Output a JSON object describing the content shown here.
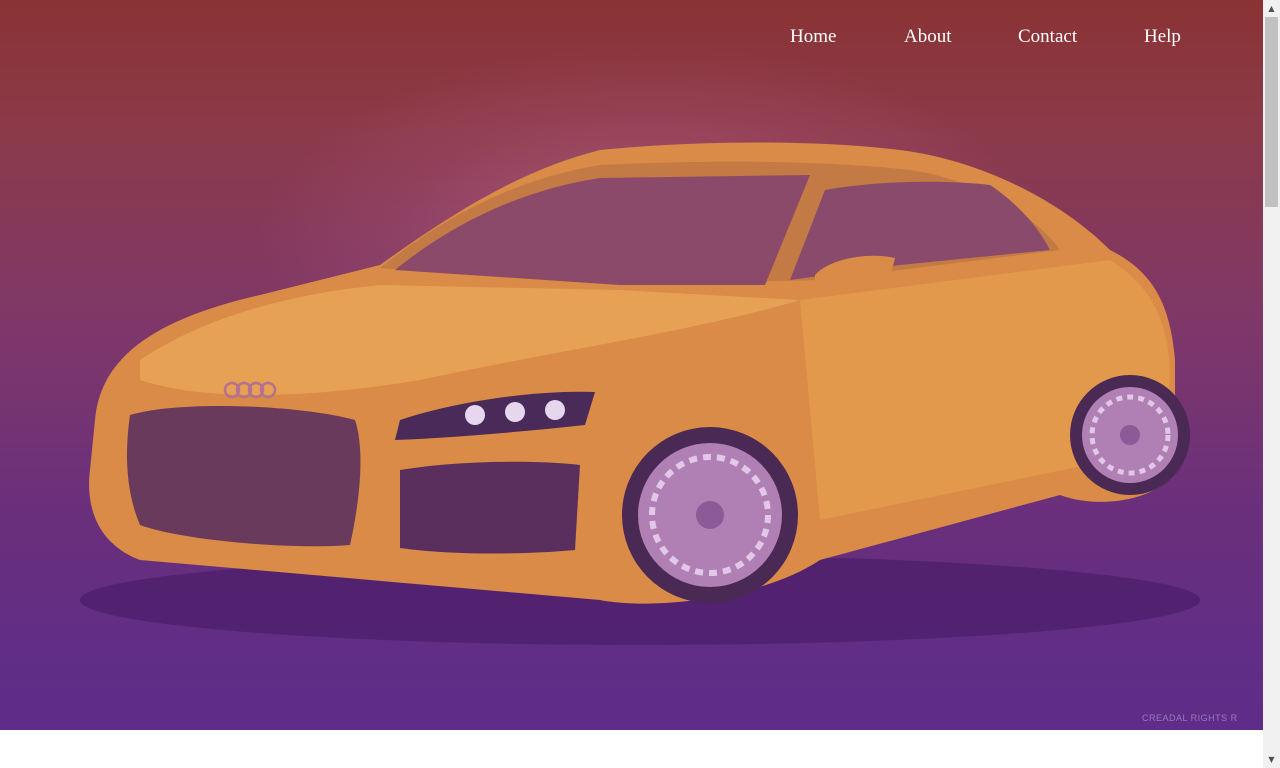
{
  "nav": {
    "items": [
      {
        "label": "Home"
      },
      {
        "label": "About"
      },
      {
        "label": "Contact"
      },
      {
        "label": "Help"
      }
    ]
  },
  "hero": {
    "car_brand_badge": "Audi",
    "watermark": "CREADAL RIGHTS R",
    "colors": {
      "overlay_top": "#8a3334",
      "overlay_bottom": "#5d2d86",
      "car_body": "#e39a4a"
    }
  },
  "scrollbar": {
    "up_icon": "triangle-up-icon",
    "down_icon": "triangle-down-icon"
  }
}
